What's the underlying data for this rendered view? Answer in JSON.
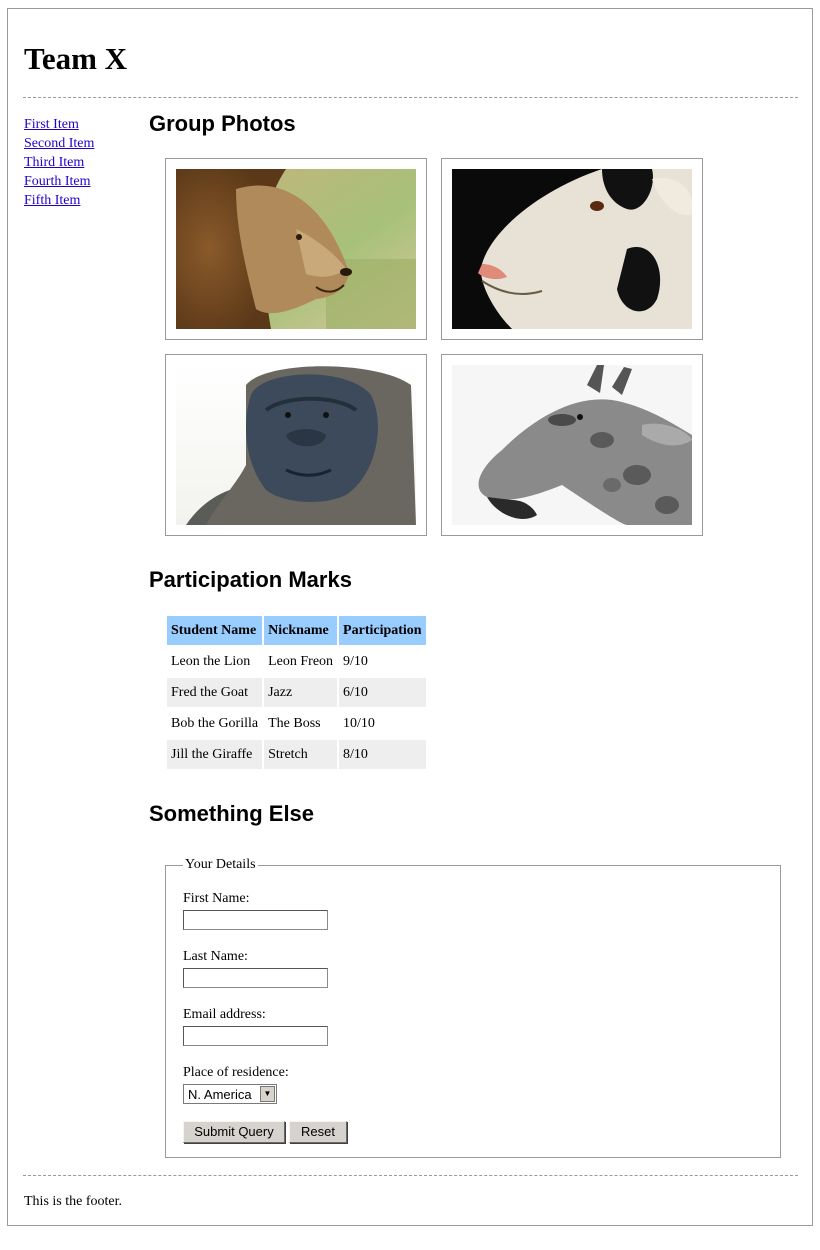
{
  "site": {
    "title": "Team X"
  },
  "sidebar": {
    "items": [
      {
        "label": "First Item"
      },
      {
        "label": "Second Item"
      },
      {
        "label": "Third Item"
      },
      {
        "label": "Fourth Item"
      },
      {
        "label": "Fifth Item"
      }
    ]
  },
  "sections": {
    "photos_title": "Group Photos",
    "marks_title": "Participation Marks",
    "else_title": "Something Else"
  },
  "photos": [
    {
      "subject": "lion"
    },
    {
      "subject": "goat"
    },
    {
      "subject": "gorilla"
    },
    {
      "subject": "giraffe"
    }
  ],
  "marks_table": {
    "headers": [
      "Student Name",
      "Nickname",
      "Participation"
    ],
    "rows": [
      [
        "Leon the Lion",
        "Leon Freon",
        "9/10"
      ],
      [
        "Fred the Goat",
        "Jazz",
        "6/10"
      ],
      [
        "Bob the Gorilla",
        "The Boss",
        "10/10"
      ],
      [
        "Jill the Giraffe",
        "Stretch",
        "8/10"
      ]
    ],
    "header_color": "#99ccff",
    "alt_row_color": "#eeeeee"
  },
  "form": {
    "legend": "Your Details",
    "first_name_label": "First Name:",
    "first_name_value": "",
    "last_name_label": "Last Name:",
    "last_name_value": "",
    "email_label": "Email address:",
    "email_value": "",
    "residence_label": "Place of residence:",
    "residence_selected": "N. America",
    "submit_label": "Submit Query",
    "reset_label": "Reset"
  },
  "footer": {
    "text": "This is the footer."
  }
}
